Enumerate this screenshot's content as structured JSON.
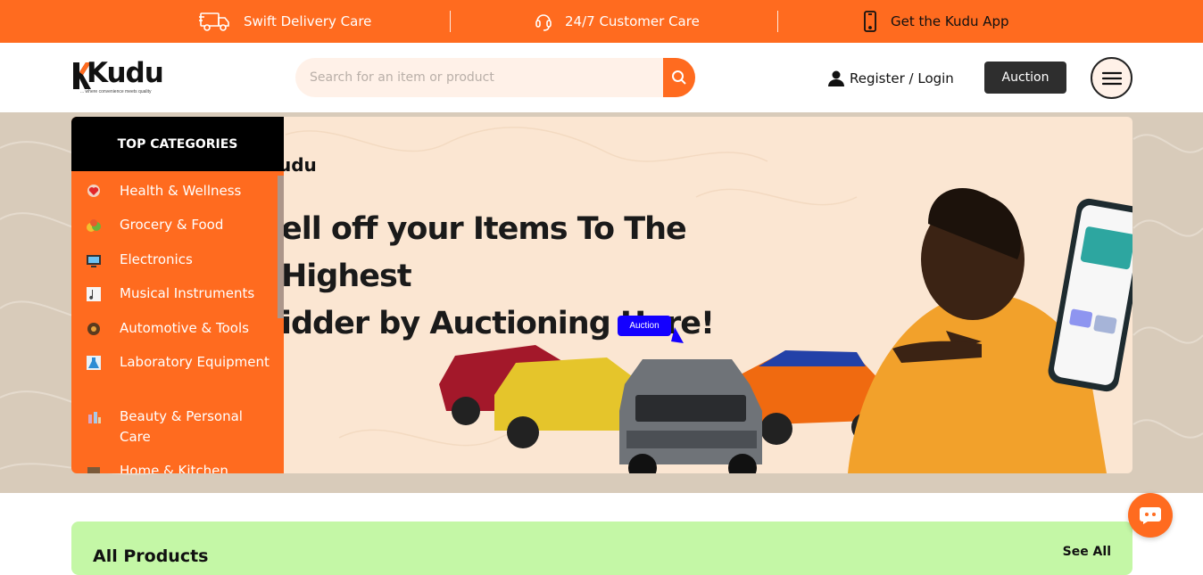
{
  "topbar": {
    "items": [
      {
        "label": "Swift Delivery Care",
        "icon": "delivery-truck-icon"
      },
      {
        "label": "24/7 Customer Care",
        "icon": "headset-icon"
      },
      {
        "label": "Get the Kudu App",
        "icon": "phone-icon"
      }
    ]
  },
  "header": {
    "logo_text": "Kudu",
    "logo_tagline": "... where convenience meets quality",
    "search_placeholder": "Search for an item or product",
    "login_label": "Register / Login",
    "auction_label": "Auction"
  },
  "sidebar": {
    "title": "TOP CATEGORIES",
    "items": [
      {
        "label": "Health & Wellness",
        "icon": "health-icon"
      },
      {
        "label": "Grocery & Food",
        "icon": "grocery-icon"
      },
      {
        "label": "Electronics",
        "icon": "electronics-icon"
      },
      {
        "label": "Musical Instruments",
        "icon": "music-icon"
      },
      {
        "label": "Automotive & Tools",
        "icon": "automotive-icon"
      },
      {
        "label": "Laboratory Equipment",
        "icon": "laboratory-icon"
      },
      {
        "label": "Beauty & Personal Care",
        "icon": "beauty-icon"
      },
      {
        "label": "Home & Kitchen",
        "icon": "home-kitchen-icon"
      }
    ]
  },
  "banner": {
    "logo_text": "udu",
    "title_line1": "ell off your Items To The Highest",
    "title_line2": "idder by Auctioning Here!",
    "tag": "Auction"
  },
  "products": {
    "title": "All Products",
    "see_all": "See All"
  },
  "colors": {
    "brand": "#FF6B1F",
    "dark": "#2E2E2E",
    "products_bg": "#C4F7A6"
  }
}
